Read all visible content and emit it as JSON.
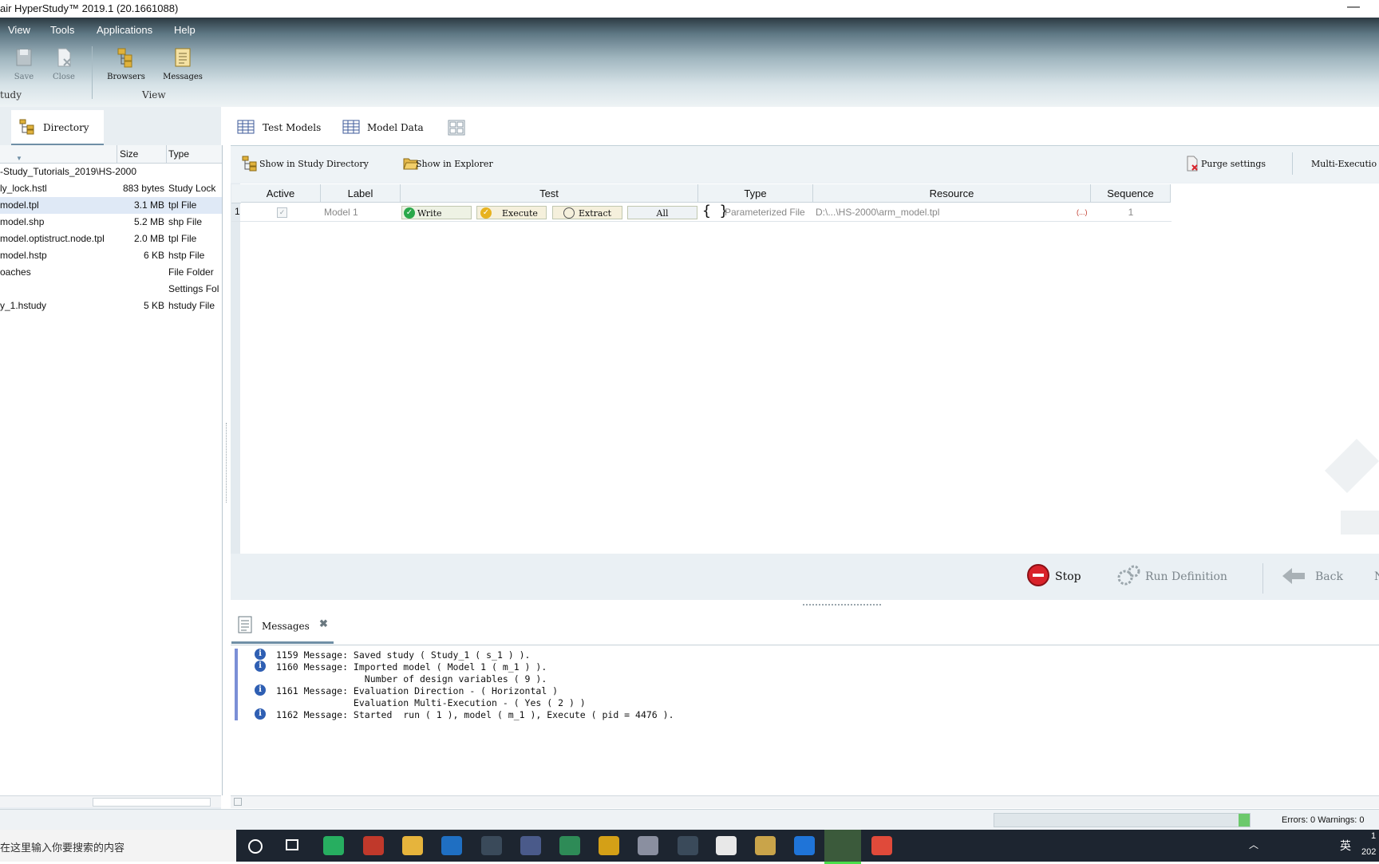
{
  "window": {
    "title": "air HyperStudy™ 2019.1 (20.1661088)",
    "minimize_label": "—"
  },
  "menu": {
    "items": [
      "View",
      "Tools",
      "Applications",
      "Help"
    ]
  },
  "ribbon": {
    "save": "Save",
    "close": "Close",
    "browsers": "Browsers",
    "messages": "Messages",
    "group_study": "tudy",
    "group_view": "View"
  },
  "left_panel": {
    "tab": "Directory",
    "columns": {
      "size": "Size",
      "type": "Type"
    },
    "path": "-Study_Tutorials_2019\\HS-2000",
    "files": [
      {
        "name": "ly_lock.hstl",
        "size": "883 bytes",
        "type": "Study Lock",
        "selected": false
      },
      {
        "name": "model.tpl",
        "size": "3.1 MB",
        "type": "tpl File",
        "selected": true
      },
      {
        "name": "model.shp",
        "size": "5.2 MB",
        "type": "shp File",
        "selected": false
      },
      {
        "name": "model.optistruct.node.tpl",
        "size": "2.0 MB",
        "type": "tpl File",
        "selected": false
      },
      {
        "name": "model.hstp",
        "size": "6 KB",
        "type": "hstp File",
        "selected": false
      },
      {
        "name": "oaches",
        "size": "",
        "type": "File Folder",
        "selected": false
      },
      {
        "name": "",
        "size": "",
        "type": "Settings Fol",
        "selected": false
      },
      {
        "name": "y_1.hstudy",
        "size": "5 KB",
        "type": "hstudy File",
        "selected": false
      }
    ]
  },
  "main_tabs": {
    "test_models": "Test Models",
    "model_data": "Model Data"
  },
  "toolbar": {
    "show_study_dir": "Show in Study Directory",
    "show_explorer": "Show in Explorer",
    "purge": "Purge settings",
    "multi_exec": "Multi-Executio"
  },
  "grid": {
    "headers": {
      "active": "Active",
      "label": "Label",
      "test": "Test",
      "type": "Type",
      "resource": "Resource",
      "sequence": "Sequence"
    },
    "row": {
      "index": "1",
      "label": "Model 1",
      "write": "Write",
      "execute": "Execute",
      "extract": "Extract",
      "all": "All",
      "type_icon": "{ }",
      "type": "Parameterized File",
      "resource": "D:\\...\\HS-2000\\arm_model.tpl",
      "resource_btn": "(...)",
      "sequence": "1"
    }
  },
  "actions": {
    "stop": "Stop",
    "run": "Run Definition",
    "back": "Back",
    "next": "N"
  },
  "messages": {
    "tab": "Messages",
    "lines": [
      {
        "icon": true,
        "text": "1159 Message: Saved study ( Study_1 ( s_1 ) )."
      },
      {
        "icon": true,
        "text": "1160 Message: Imported model ( Model 1 ( m_1 ) )."
      },
      {
        "icon": false,
        "text": "                Number of design variables ( 9 )."
      },
      {
        "icon": true,
        "text": "1161 Message: Evaluation Direction - ( Horizontal )"
      },
      {
        "icon": false,
        "text": "              Evaluation Multi-Execution - ( Yes ( 2 ) )"
      },
      {
        "icon": true,
        "text": "1162 Message: Started  run ( 1 ), model ( m_1 ), Execute ( pid = 4476 )."
      }
    ]
  },
  "status": {
    "errors": "Errors: 0  Warnings: 0"
  },
  "taskbar": {
    "search_placeholder": "在这里输入你要搜索的内容",
    "ime": "英",
    "clock_top": "1",
    "clock_bottom": "202"
  },
  "colors": {
    "accent": "#6f8fa6",
    "stop_red": "#d9222a",
    "check_green": "#2aa84a",
    "taskbar": "#1d2530"
  }
}
